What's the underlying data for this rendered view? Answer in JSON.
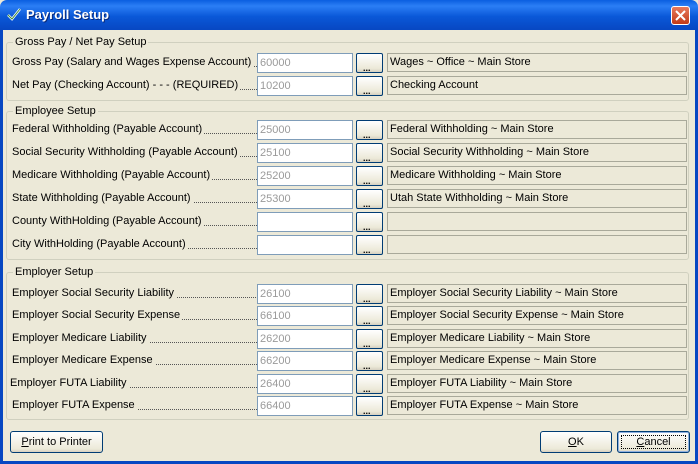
{
  "window": {
    "title": "Payroll Setup",
    "titlebar_color": "#0a58d8",
    "close_icon": "close-icon"
  },
  "groups": [
    {
      "legend": "Gross Pay / Net Pay Setup",
      "rows": [
        {
          "label": "Gross Pay (Salary and Wages Expense Account)",
          "account": "60000",
          "description": "Wages ~ Office ~ Main Store"
        },
        {
          "label": "Net Pay (Checking Account) - - - (REQUIRED)",
          "account": "10200",
          "description": "Checking Account"
        }
      ]
    },
    {
      "legend": "Employee Setup",
      "rows": [
        {
          "label": "Federal Withholding (Payable Account)",
          "account": "25000",
          "description": "Federal Withholding ~ Main Store"
        },
        {
          "label": "Social Security Withholding (Payable Account)",
          "account": "25100",
          "description": "Social Security Withholding ~ Main Store"
        },
        {
          "label": "Medicare Withholding (Payable Account)",
          "account": "25200",
          "description": "Medicare Withholding ~ Main Store"
        },
        {
          "label": "State Withholding (Payable Account)",
          "account": "25300",
          "description": "Utah State Withholding ~ Main Store"
        },
        {
          "label": "County WithHolding (Payable Account)",
          "account": "",
          "description": ""
        },
        {
          "label": "City WithHolding (Payable Account)",
          "account": "",
          "description": ""
        }
      ]
    },
    {
      "legend": "Employer Setup",
      "rows": [
        {
          "label": "Employer Social Security Liability",
          "account": "26100",
          "description": "Employer Social Security Liability ~ Main Store"
        },
        {
          "label": "Employer Social Security Expense",
          "account": "66100",
          "description": "Employer Social Security Expense ~ Main Store"
        },
        {
          "label": "Employer Medicare  Liability",
          "account": "26200",
          "description": "Employer Medicare Liability ~ Main Store"
        },
        {
          "label": "Employer Medicare Expense",
          "account": "66200",
          "description": "Employer Medicare Expense ~ Main Store"
        },
        {
          "label": "Employer FUTA  Liability",
          "account": "26400",
          "description": "Employer FUTA Liability ~ Main Store"
        },
        {
          "label": "Employer FUTA Expense",
          "account": "66400",
          "description": "Employer FUTA Expense ~ Main Store"
        }
      ]
    }
  ],
  "lookup_button_glyph": "...",
  "buttons": {
    "print": {
      "mnemonic": "P",
      "rest": "rint to Printer"
    },
    "ok": {
      "mnemonic": "O",
      "rest": "K"
    },
    "cancel": {
      "mnemonic": "C",
      "rest": "ancel"
    }
  }
}
